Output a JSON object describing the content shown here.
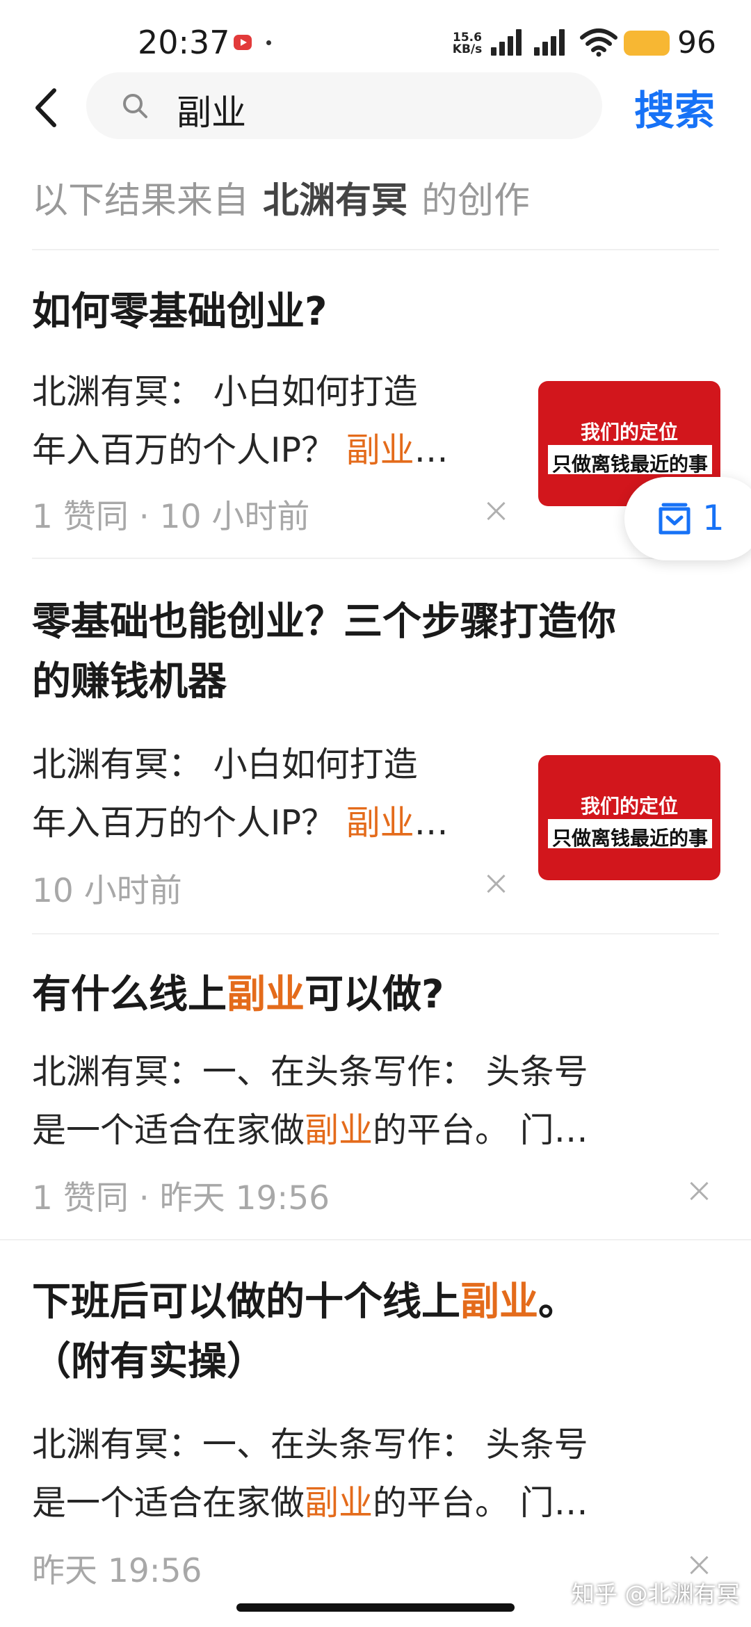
{
  "status_bar": {
    "time": "20:37",
    "net_speed_value": "15.6",
    "net_speed_unit": "KB/s",
    "battery": "96",
    "icons": [
      "record-icon",
      "signal-icon",
      "wifi-icon",
      "battery-icon"
    ]
  },
  "search": {
    "query": "副业",
    "submit_label": "搜索"
  },
  "source": {
    "prefix": "以下结果来自",
    "author": "北渊有冥",
    "suffix": "的创作"
  },
  "results": [
    {
      "title": "如何零基础创业?",
      "excerpt_line1": "北渊有冥： 小白如何打造",
      "excerpt_line2_pre": "年入百万的个人IP？ ",
      "excerpt_line2_hl": "副业",
      "excerpt_line2_post": "…",
      "meta": "1 赞同 · 10 小时前",
      "thumb_line1": "我们的定位",
      "thumb_line2": "只做离钱最近的事"
    },
    {
      "title_line1": "零基础也能创业？三个步骤打造你",
      "title_line2": "的赚钱机器",
      "excerpt_line1": "北渊有冥： 小白如何打造",
      "excerpt_line2_pre": "年入百万的个人IP？ ",
      "excerpt_line2_hl": "副业",
      "excerpt_line2_post": "…",
      "meta": "10 小时前",
      "thumb_line1": "我们的定位",
      "thumb_line2": "只做离钱最近的事"
    },
    {
      "title_pre": "有什么线上",
      "title_hl": "副业",
      "title_post": "可以做?",
      "excerpt_line1": "北渊有冥：一、在头条写作： 头条号",
      "excerpt_line2_pre": "是一个适合在家做",
      "excerpt_line2_hl": "副业",
      "excerpt_line2_post": "的平台。 门…",
      "meta": "1 赞同 · 昨天 19:56"
    },
    {
      "title_line1_pre": "下班后可以做的十个线上",
      "title_line1_hl": "副业",
      "title_line1_post": "。",
      "title_line2": "（附有实操）",
      "excerpt_line1": "北渊有冥：一、在头条写作： 头条号",
      "excerpt_line2_pre": "是一个适合在家做",
      "excerpt_line2_hl": "副业",
      "excerpt_line2_post": "的平台。 门…",
      "meta": "昨天 19:56"
    }
  ],
  "floating": {
    "count": "1"
  },
  "watermark": "知乎 @北渊有冥",
  "colors": {
    "accent": "#1772f6",
    "highlight": "#e46b1b",
    "thumb_red": "#d2161c",
    "meta_gray": "#a8a8a8"
  }
}
